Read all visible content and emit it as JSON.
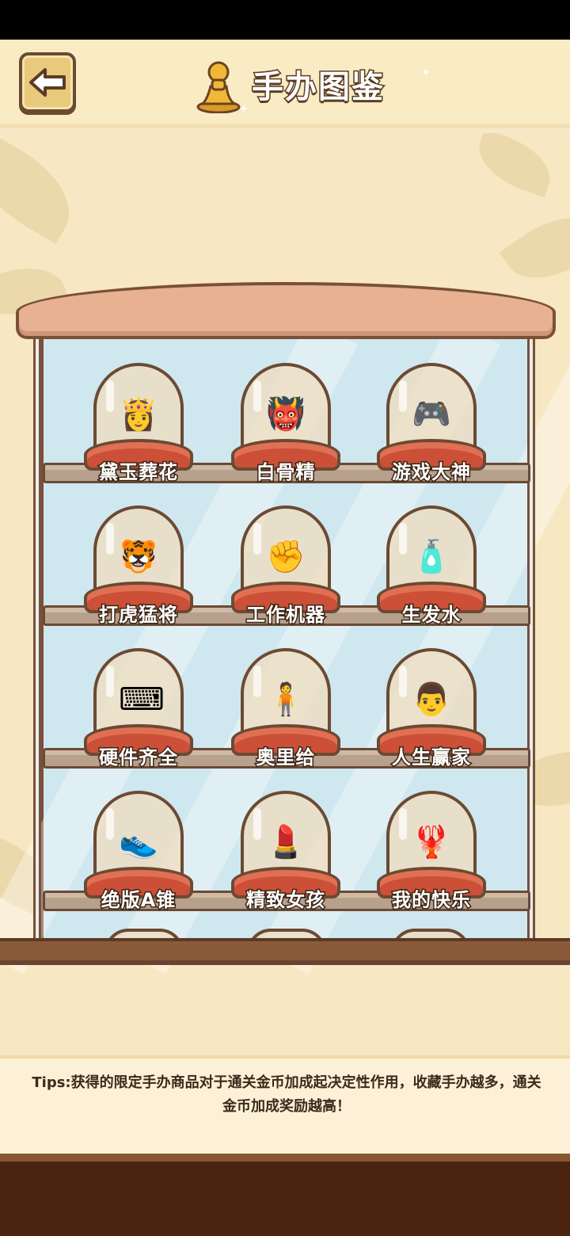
{
  "header": {
    "title": "手办图鉴",
    "back_icon": "arrow-left-icon"
  },
  "shelves": [
    {
      "items": [
        {
          "label": "黛玉葬花",
          "icon": "👸"
        },
        {
          "label": "白骨精",
          "icon": "👹"
        },
        {
          "label": "游戏大神",
          "icon": "🎮"
        }
      ]
    },
    {
      "items": [
        {
          "label": "打虎猛将",
          "icon": "🐯"
        },
        {
          "label": "工作机器",
          "icon": "✊"
        },
        {
          "label": "生发水",
          "icon": "🧴"
        }
      ]
    },
    {
      "items": [
        {
          "label": "硬件齐全",
          "icon": "⌨"
        },
        {
          "label": "奥里给",
          "icon": "🧍"
        },
        {
          "label": "人生赢家",
          "icon": "👨"
        }
      ]
    },
    {
      "items": [
        {
          "label": "绝版A锥",
          "icon": "👟"
        },
        {
          "label": "精致女孩",
          "icon": "💄"
        },
        {
          "label": "我的快乐",
          "icon": "🦞"
        }
      ]
    }
  ],
  "tips": "Tips:获得的限定手办商品对于通关金币加成起决定性作用，收藏手办越多，通关金币加成奖励越高！",
  "colors": {
    "plinth": "#cc4f38",
    "frame": "#7a5036",
    "background": "#f7e7c3"
  }
}
